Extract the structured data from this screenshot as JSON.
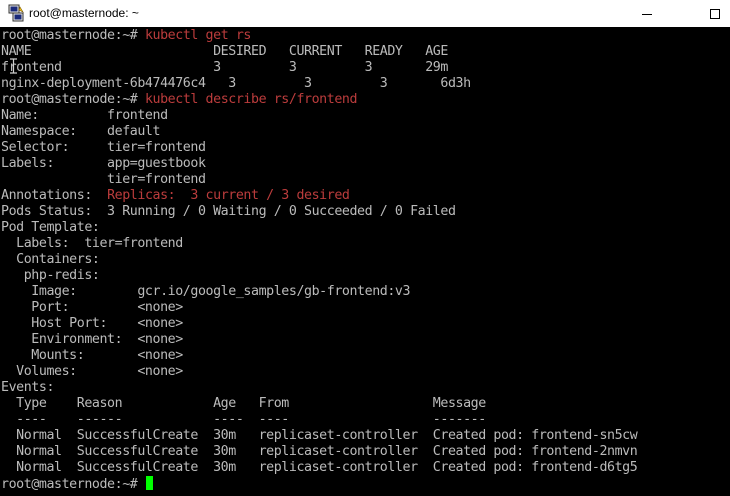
{
  "window": {
    "title": "root@masternode: ~",
    "icons": {
      "app": "putty-icon",
      "minimize": "minimize-icon",
      "maximize": "maximize-icon"
    }
  },
  "colors": {
    "background": "#000000",
    "text": "#bbbbbb",
    "command": "#bb3c3c",
    "cursor": "#00ff00"
  },
  "terminal": {
    "lines": [
      {
        "prompt": "root@masternode:~# ",
        "cmd": "kubectl get rs"
      },
      {
        "text": "NAME                        DESIRED   CURRENT   READY   AGE"
      },
      {
        "text": "frontend                    3         3         3       29m"
      },
      {
        "text": "nginx-deployment-6b474476c4   3         3         3       6d3h"
      },
      {
        "prompt": "root@masternode:~# ",
        "cmd": "kubectl describe rs/frontend"
      },
      {
        "text": "Name:         frontend"
      },
      {
        "text": "Namespace:    default"
      },
      {
        "text": "Selector:     tier=frontend"
      },
      {
        "text": "Labels:       app=guestbook"
      },
      {
        "text": "              tier=frontend"
      },
      {
        "prompt": "Annotations:  ",
        "cmd": "Replicas:  3 current / 3 desired"
      },
      {
        "text": "Pods Status:  3 Running / 0 Waiting / 0 Succeeded / 0 Failed"
      },
      {
        "text": "Pod Template:"
      },
      {
        "text": "  Labels:  tier=frontend"
      },
      {
        "text": "  Containers:"
      },
      {
        "text": "   php-redis:"
      },
      {
        "text": "    Image:        gcr.io/google_samples/gb-frontend:v3"
      },
      {
        "text": "    Port:         <none>"
      },
      {
        "text": "    Host Port:    <none>"
      },
      {
        "text": "    Environment:  <none>"
      },
      {
        "text": "    Mounts:       <none>"
      },
      {
        "text": "  Volumes:        <none>"
      },
      {
        "text": "Events:"
      },
      {
        "text": "  Type    Reason            Age   From                   Message"
      },
      {
        "text": "  ----    ------            ----  ----                   -------"
      },
      {
        "text": "  Normal  SuccessfulCreate  30m   replicaset-controller  Created pod: frontend-sn5cw"
      },
      {
        "text": "  Normal  SuccessfulCreate  30m   replicaset-controller  Created pod: frontend-2nmvn"
      },
      {
        "text": "  Normal  SuccessfulCreate  30m   replicaset-controller  Created pod: frontend-d6tg5"
      },
      {
        "prompt": "root@masternode:~# ",
        "cmd": "",
        "cursor": true
      }
    ]
  }
}
